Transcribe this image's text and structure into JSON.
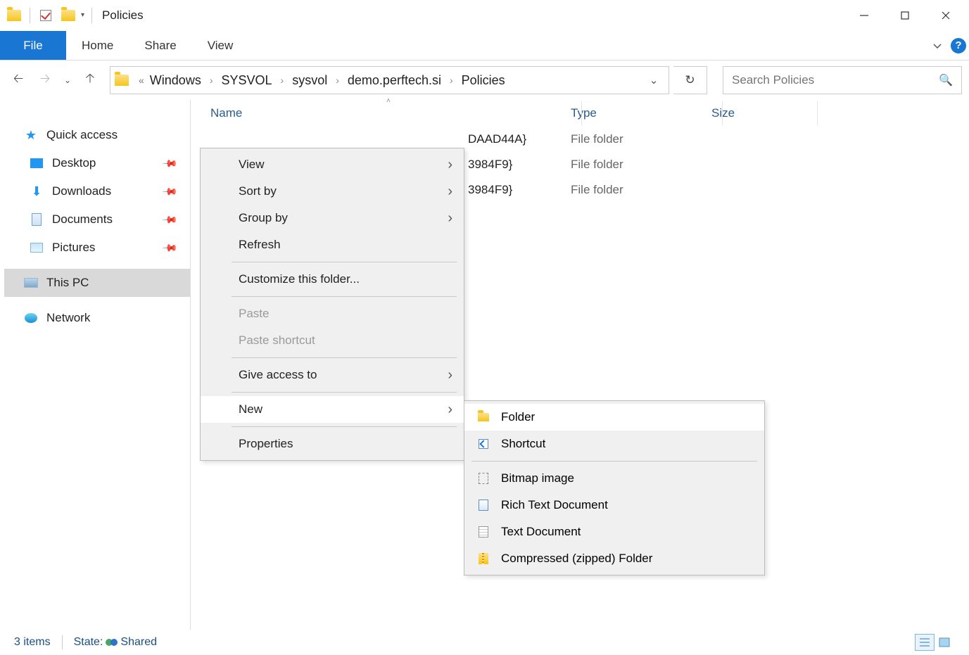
{
  "window": {
    "title": "Policies"
  },
  "ribbon": {
    "file": "File",
    "home": "Home",
    "share": "Share",
    "view": "View"
  },
  "breadcrumbs": [
    "Windows",
    "SYSVOL",
    "sysvol",
    "demo.perftech.si",
    "Policies"
  ],
  "search": {
    "placeholder": "Search Policies"
  },
  "nav": {
    "quick_access": "Quick access",
    "desktop": "Desktop",
    "downloads": "Downloads",
    "documents": "Documents",
    "pictures": "Pictures",
    "this_pc": "This PC",
    "network": "Network"
  },
  "columns": {
    "name": "Name",
    "type": "Type",
    "size": "Size"
  },
  "files": [
    {
      "name_visible": "DAAD44A}",
      "type": "File folder"
    },
    {
      "name_visible": "3984F9}",
      "type": "File folder"
    },
    {
      "name_visible": "3984F9}",
      "type": "File folder"
    }
  ],
  "context_menu": {
    "view": "View",
    "sort_by": "Sort by",
    "group_by": "Group by",
    "refresh": "Refresh",
    "customize": "Customize this folder...",
    "paste": "Paste",
    "paste_shortcut": "Paste shortcut",
    "give_access": "Give access to",
    "new": "New",
    "properties": "Properties"
  },
  "submenu_new": {
    "folder": "Folder",
    "shortcut": "Shortcut",
    "bitmap": "Bitmap image",
    "rtf": "Rich Text Document",
    "txt": "Text Document",
    "zip": "Compressed (zipped) Folder"
  },
  "status": {
    "items": "3 items",
    "state_label": "State:",
    "state_value": "Shared"
  }
}
